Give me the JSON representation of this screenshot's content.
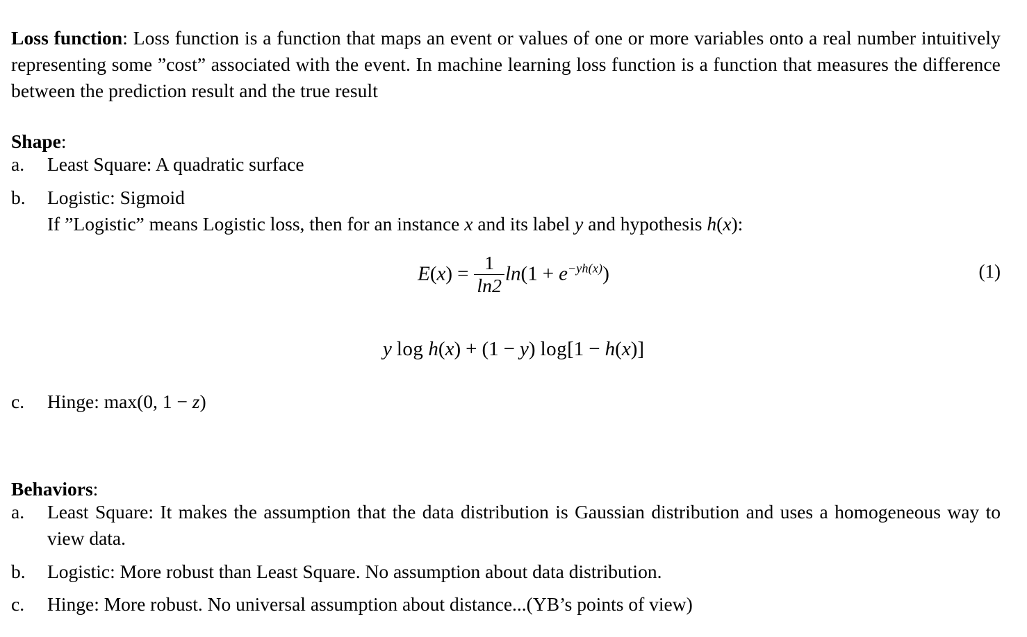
{
  "document": {
    "type": "latex-lecture-notes",
    "background_color": "#ffffff",
    "text_color": "#000000"
  },
  "intro": {
    "term": "Loss function",
    "colon": ":",
    "body": " Loss function is a function that maps an event or values of one or more variables onto a real number intuitively representing some ”cost” associated with the event. In machine learning loss function is a function that measures the difference between the prediction result and the true result"
  },
  "sections": [
    {
      "heading": "Shape",
      "heading_colon": ":",
      "items": [
        {
          "marker": "a.",
          "text": "Least Square: A quadratic surface"
        },
        {
          "marker": "b.",
          "text": "Logistic: Sigmoid",
          "subline": "If ”Logistic” means Logistic loss, then for an instance x and its label y and hypothesis h(x):"
        },
        {
          "marker": "c.",
          "text": "Hinge: max(0, 1 − z)"
        }
      ]
    },
    {
      "heading": "Behaviors",
      "heading_colon": ":",
      "items": [
        {
          "marker": "a.",
          "text": "Least Square: It makes the assumption that the data distribution is Gaussian distribution and uses a homogeneous way to view data."
        },
        {
          "marker": "b.",
          "text": "Logistic: More robust than Least Square. No assumption about data distribution."
        },
        {
          "marker": "c.",
          "text": "Hinge: More robust. No universal assumption about distance...(YB’s points of view)"
        }
      ]
    }
  ],
  "equations": [
    {
      "number": "(1)",
      "latex": "E(x) = \\frac{1}{ln2} ln(1 + e^{-yh(x)})",
      "plain": "E(x) = (1/ln2) ln(1 + e^{-yh(x)})",
      "parts": {
        "lhs": "E(x)",
        "equals": "=",
        "frac_num": "1",
        "frac_den": "ln2",
        "ln": "ln",
        "open": "(",
        "one": "1",
        "plus": "+",
        "e": "e",
        "exponent": "−yh(x)",
        "close": ")"
      }
    },
    {
      "number": "",
      "latex": "y \\log h(x) + (1 - y) \\log[1 - h(x)]",
      "plain": "y log h(x) + (1 − y) log[1 − h(x)]",
      "parts": {
        "y": "y",
        "log1": "log",
        "hx1": "h(x)",
        "plus": "+",
        "group": "(1 − y)",
        "log2": "log",
        "bracket": "[1 − h(x)]"
      }
    }
  ],
  "inline_math": {
    "sub_x": "x",
    "sub_y": "y",
    "sub_hx": "h(x)",
    "hinge_expr": "max(0, 1 − z)"
  },
  "list_text_parts": {
    "shape_b_subline_pre": "If ”Logistic” means Logistic loss, then for an instance ",
    "shape_b_subline_mid1": " and its label ",
    "shape_b_subline_mid2": " and hypothesis ",
    "shape_b_subline_end": ":",
    "shape_c_pre": "Hinge: ",
    "shape_c_max": "max",
    "shape_c_args": "(0, 1 − ",
    "shape_c_z": "z",
    "shape_c_close": ")"
  }
}
